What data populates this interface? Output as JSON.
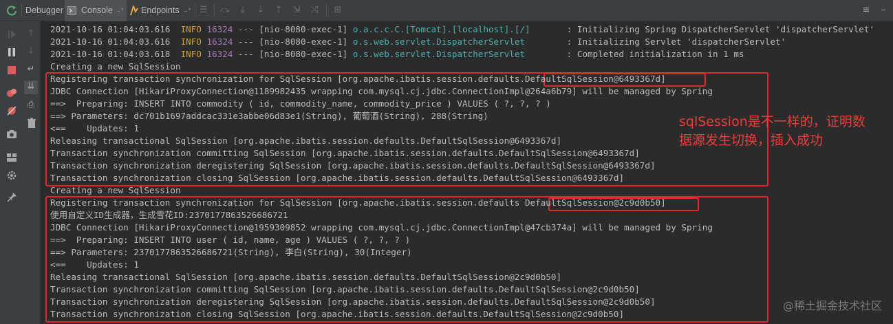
{
  "header": {
    "tabs": [
      {
        "label": "Debugger"
      },
      {
        "label": "Console",
        "pin": "→*"
      },
      {
        "label": "Endpoints",
        "pin": "→*"
      }
    ]
  },
  "console": {
    "lines": [
      [
        {
          "t": "2021-10-16 01:04:03.616  "
        },
        {
          "t": "INFO",
          "c": "info"
        },
        {
          "t": " "
        },
        {
          "t": "16324",
          "c": "pid"
        },
        {
          "t": " --- [nio-8080-exec-1] "
        },
        {
          "t": "o.a.c.c.C.[Tomcat].[localhost].[/]      ",
          "c": "cls"
        },
        {
          "t": " : Initializing Spring DispatcherServlet 'dispatcherServlet'"
        }
      ],
      [
        {
          "t": "2021-10-16 01:04:03.616  "
        },
        {
          "t": "INFO",
          "c": "info"
        },
        {
          "t": " "
        },
        {
          "t": "16324",
          "c": "pid"
        },
        {
          "t": " --- [nio-8080-exec-1] "
        },
        {
          "t": "o.s.web.servlet.DispatcherServlet       ",
          "c": "cls"
        },
        {
          "t": " : Initializing Servlet 'dispatcherServlet'"
        }
      ],
      [
        {
          "t": "2021-10-16 01:04:03.618  "
        },
        {
          "t": "INFO",
          "c": "info"
        },
        {
          "t": " "
        },
        {
          "t": "16324",
          "c": "pid"
        },
        {
          "t": " --- [nio-8080-exec-1] "
        },
        {
          "t": "o.s.web.servlet.DispatcherServlet       ",
          "c": "cls"
        },
        {
          "t": " : Completed initialization in 1 ms"
        }
      ],
      [
        {
          "t": "Creating a new SqlSession"
        }
      ],
      [
        {
          "t": "Registering transaction synchronization for SqlSession [org.apache.ibatis.session.defaults.DefaultSqlSession@6493367d]"
        }
      ],
      [
        {
          "t": "JDBC Connection [HikariProxyConnection@1189982435 wrapping com.mysql.cj.jdbc.ConnectionImpl@264a6b79] will be managed by Spring"
        }
      ],
      [
        {
          "t": "==>  Preparing: INSERT INTO commodity ( id, commodity_name, commodity_price ) VALUES ( ?, ?, ? )"
        }
      ],
      [
        {
          "t": "==> Parameters: dc701b1697addcac331e3abbe06d83e1(String), 葡萄酒(String), 288(String)"
        }
      ],
      [
        {
          "t": "<==    Updates: 1"
        }
      ],
      [
        {
          "t": "Releasing transactional SqlSession [org.apache.ibatis.session.defaults.DefaultSqlSession@6493367d]"
        }
      ],
      [
        {
          "t": "Transaction synchronization committing SqlSession [org.apache.ibatis.session.defaults.DefaultSqlSession@6493367d]"
        }
      ],
      [
        {
          "t": "Transaction synchronization deregistering SqlSession [org.apache.ibatis.session.defaults.DefaultSqlSession@6493367d]"
        }
      ],
      [
        {
          "t": "Transaction synchronization closing SqlSession [org.apache.ibatis.session.defaults.DefaultSqlSession@6493367d]"
        }
      ],
      [
        {
          "t": "Creating a new SqlSession"
        }
      ],
      [
        {
          "t": "Registering transaction synchronization for SqlSession [org.apache.ibatis.session.defaults DefaultSqlSession@2c9d0b50]"
        }
      ],
      [
        {
          "t": "使用自定义ID生成器，生成雪花ID:2370177863526686721"
        }
      ],
      [
        {
          "t": "JDBC Connection [HikariProxyConnection@1959309852 wrapping com.mysql.cj.jdbc.ConnectionImpl@47cb374a] will be managed by Spring"
        }
      ],
      [
        {
          "t": "==>  Preparing: INSERT INTO user ( id, name, age ) VALUES ( ?, ?, ? )"
        }
      ],
      [
        {
          "t": "==> Parameters: 2370177863526686721(String), 李白(String), 30(Integer)"
        }
      ],
      [
        {
          "t": "<==    Updates: 1"
        }
      ],
      [
        {
          "t": "Releasing transactional SqlSession [org.apache.ibatis.session.defaults.DefaultSqlSession@2c9d0b50]"
        }
      ],
      [
        {
          "t": "Transaction synchronization committing SqlSession [org.apache.ibatis.session.defaults.DefaultSqlSession@2c9d0b50]"
        }
      ],
      [
        {
          "t": "Transaction synchronization deregistering SqlSession [org.apache.ibatis.session.defaults.DefaultSqlSession@2c9d0b50]"
        }
      ],
      [
        {
          "t": "Transaction synchronization closing SqlSession [org.apache.ibatis.session.defaults.DefaultSqlSession@2c9d0b50]"
        }
      ]
    ]
  },
  "annotation": {
    "line1": "sqlSession是不一样的，证明数",
    "line2": "据源发生切换，插入成功",
    "color": "#f03a3a"
  },
  "watermark": "@稀土掘金技术社区",
  "colors": {
    "background": "#2b2b2b",
    "info": "#d0a32c",
    "pid": "#a679b8",
    "logger": "#4cb1ae",
    "highlight_box": "#e8272d"
  }
}
